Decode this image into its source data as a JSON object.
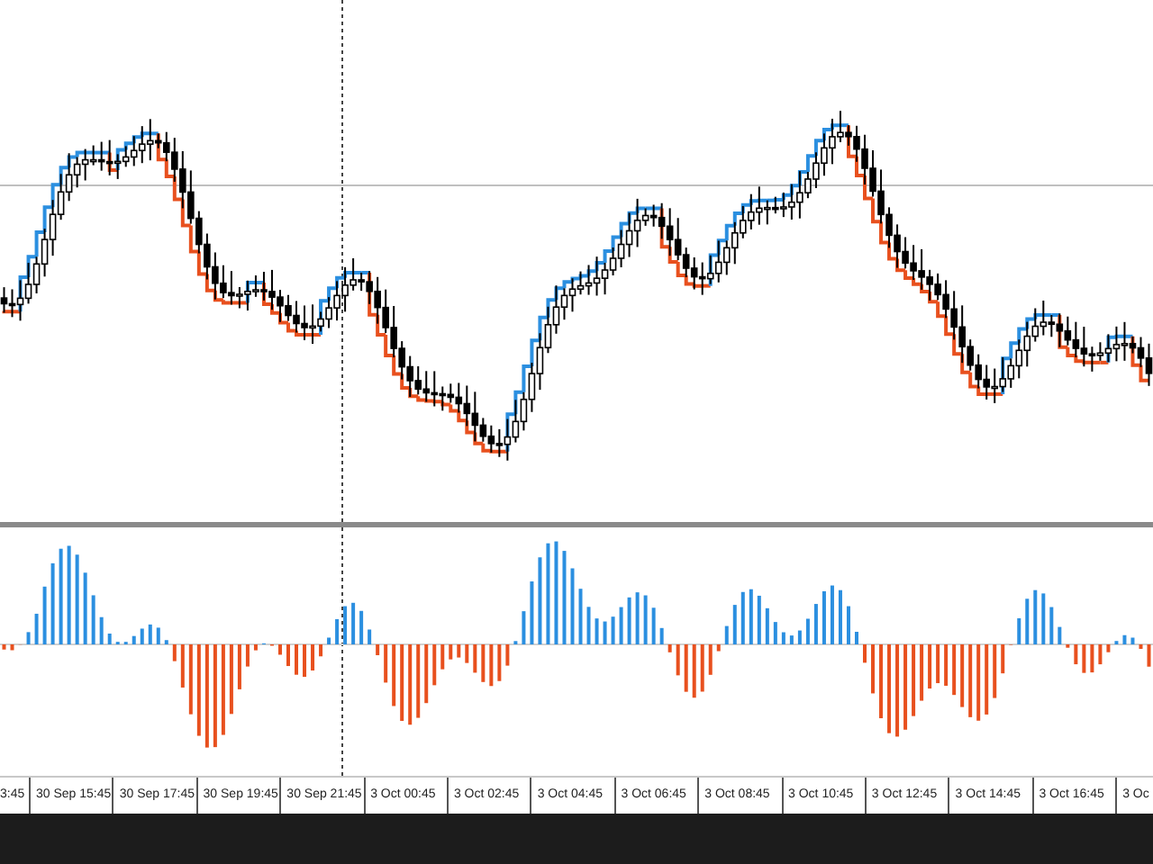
{
  "time_axis": {
    "labels": [
      "3:45",
      "30 Sep 15:45",
      "30 Sep 17:45",
      "30 Sep 19:45",
      "30 Sep 21:45",
      "3 Oct 00:45",
      "3 Oct 02:45",
      "3 Oct 04:45",
      "3 Oct 06:45",
      "3 Oct 08:45",
      "3 Oct 10:45",
      "3 Oct 12:45",
      "3 Oct 14:45",
      "3 Oct 16:45",
      "3 Oc"
    ]
  }
}
